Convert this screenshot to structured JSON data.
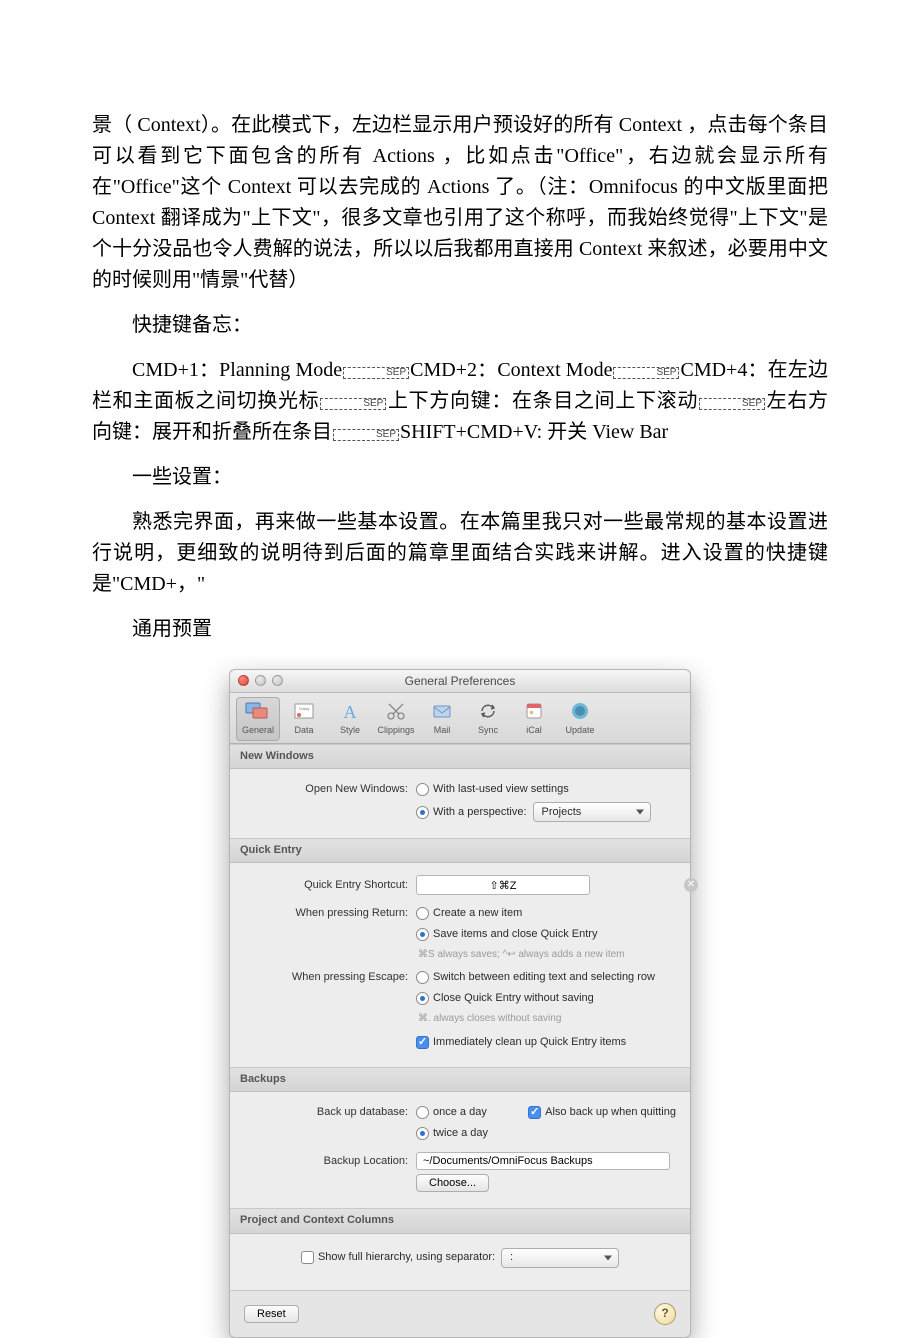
{
  "article": {
    "p1": "景（ Context）。在此模式下，左边栏显示用户预设好的所有 Context ，点击每个条目可以看到它下面包含的所有 Actions ，比如点击\"Office\"，右边就会显示所有在\"Office\"这个 Context 可以去完成的 Actions 了。（注：Omnifocus 的中文版里面把 Context 翻译成为\"上下文\"，很多文章也引用了这个称呼，而我始终觉得\"上下文\"是个十分没品也令人费解的说法，所以以后我都用直接用 Context 来叙述，必要用中文的时候则用\"情景\"代替）",
    "p2": "快捷键备忘：",
    "p3a": "CMD+1：Planning Mode",
    "p3b": "CMD+2：Context Mode",
    "p3c": "CMD+4：在左边栏和主面板之间切换光标",
    "p3d": "上下方向键：在条目之间上下滚动",
    "p3e": "左右方向键：展开和折叠所在条目",
    "p3f": "SHIFT+CMD+V: 开关 View Bar",
    "p4": "一些设置：",
    "p5": "熟悉完界面，再来做一些基本设置。在本篇里我只对一些最常规的基本设置进行说明，更细致的说明待到后面的篇章里面结合实践来讲解。进入设置的快捷键是\"CMD+，\"",
    "p6": "通用预置"
  },
  "sep_label": "SEP",
  "prefs": {
    "title": "General Preferences",
    "toolbar": [
      {
        "label": "General",
        "selected": true
      },
      {
        "label": "Data"
      },
      {
        "label": "Style"
      },
      {
        "label": "Clippings"
      },
      {
        "label": "Mail"
      },
      {
        "label": "Sync"
      },
      {
        "label": "iCal"
      },
      {
        "label": "Update"
      }
    ],
    "sections": {
      "new_windows": {
        "header": "New Windows",
        "label": "Open New Windows:",
        "opt_last": "With last-used view settings",
        "opt_persp": "With a perspective:",
        "perspective_value": "Projects"
      },
      "quick_entry": {
        "header": "Quick Entry",
        "shortcut_label": "Quick Entry Shortcut:",
        "shortcut_value": "⇧⌘Z",
        "return_label": "When pressing Return:",
        "return_opt1": "Create a new item",
        "return_opt2": "Save items and close Quick Entry",
        "return_hint": "⌘S always saves; ^↩ always adds a new item",
        "escape_label": "When pressing Escape:",
        "escape_opt1": "Switch between editing text and selecting row",
        "escape_opt2": "Close Quick Entry without saving",
        "escape_hint": "⌘. always closes without saving",
        "cleanup_label": "Immediately clean up Quick Entry items"
      },
      "backups": {
        "header": "Backups",
        "db_label": "Back up database:",
        "opt_once": "once a day",
        "opt_twice": "twice a day",
        "also_quit": "Also back up when quitting",
        "loc_label": "Backup Location:",
        "loc_value": "~/Documents/OmniFocus Backups",
        "choose": "Choose..."
      },
      "columns": {
        "header": "Project and Context Columns",
        "show_label": "Show full hierarchy, using separator:",
        "sep_value": ":"
      }
    },
    "reset": "Reset",
    "help": "?"
  }
}
